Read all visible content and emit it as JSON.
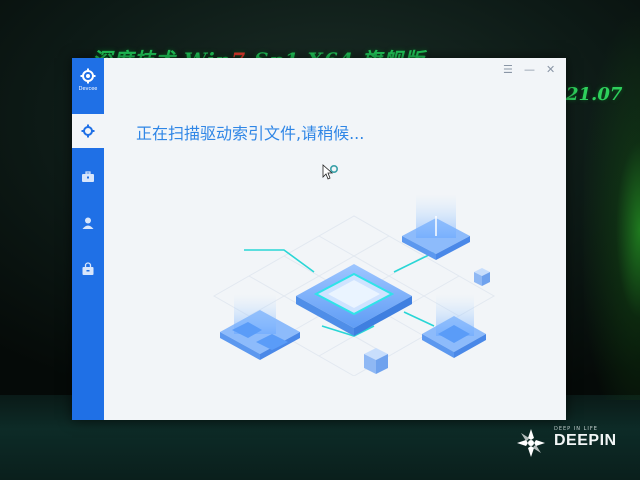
{
  "desktop": {
    "wallpaper_title_prefix": "深度技术 Win",
    "wallpaper_title_seven": "7",
    "wallpaper_title_suffix": " Sp1 X64 旗舰版",
    "wallpaper_version": "21.07",
    "brand_tagline": "DEEP IN LIFE",
    "brand_name": "DEEPIN"
  },
  "app": {
    "logo_label": "Devcee",
    "logo_icon": "gear-logo-icon",
    "sidebar": [
      {
        "id": "settings",
        "icon": "gear-icon",
        "active": true
      },
      {
        "id": "toolbox",
        "icon": "toolbox-icon",
        "active": false
      },
      {
        "id": "user",
        "icon": "user-icon",
        "active": false
      },
      {
        "id": "bag",
        "icon": "bag-icon",
        "active": false
      }
    ],
    "window_controls": {
      "menu": "☰",
      "minimize": "—",
      "close": "✕"
    },
    "status_text": "正在扫描驱动索引文件,请稍候...",
    "colors": {
      "sidebar": "#1f70e6",
      "accent": "#2f86e6",
      "content_bg": "#f2f5f8"
    }
  }
}
